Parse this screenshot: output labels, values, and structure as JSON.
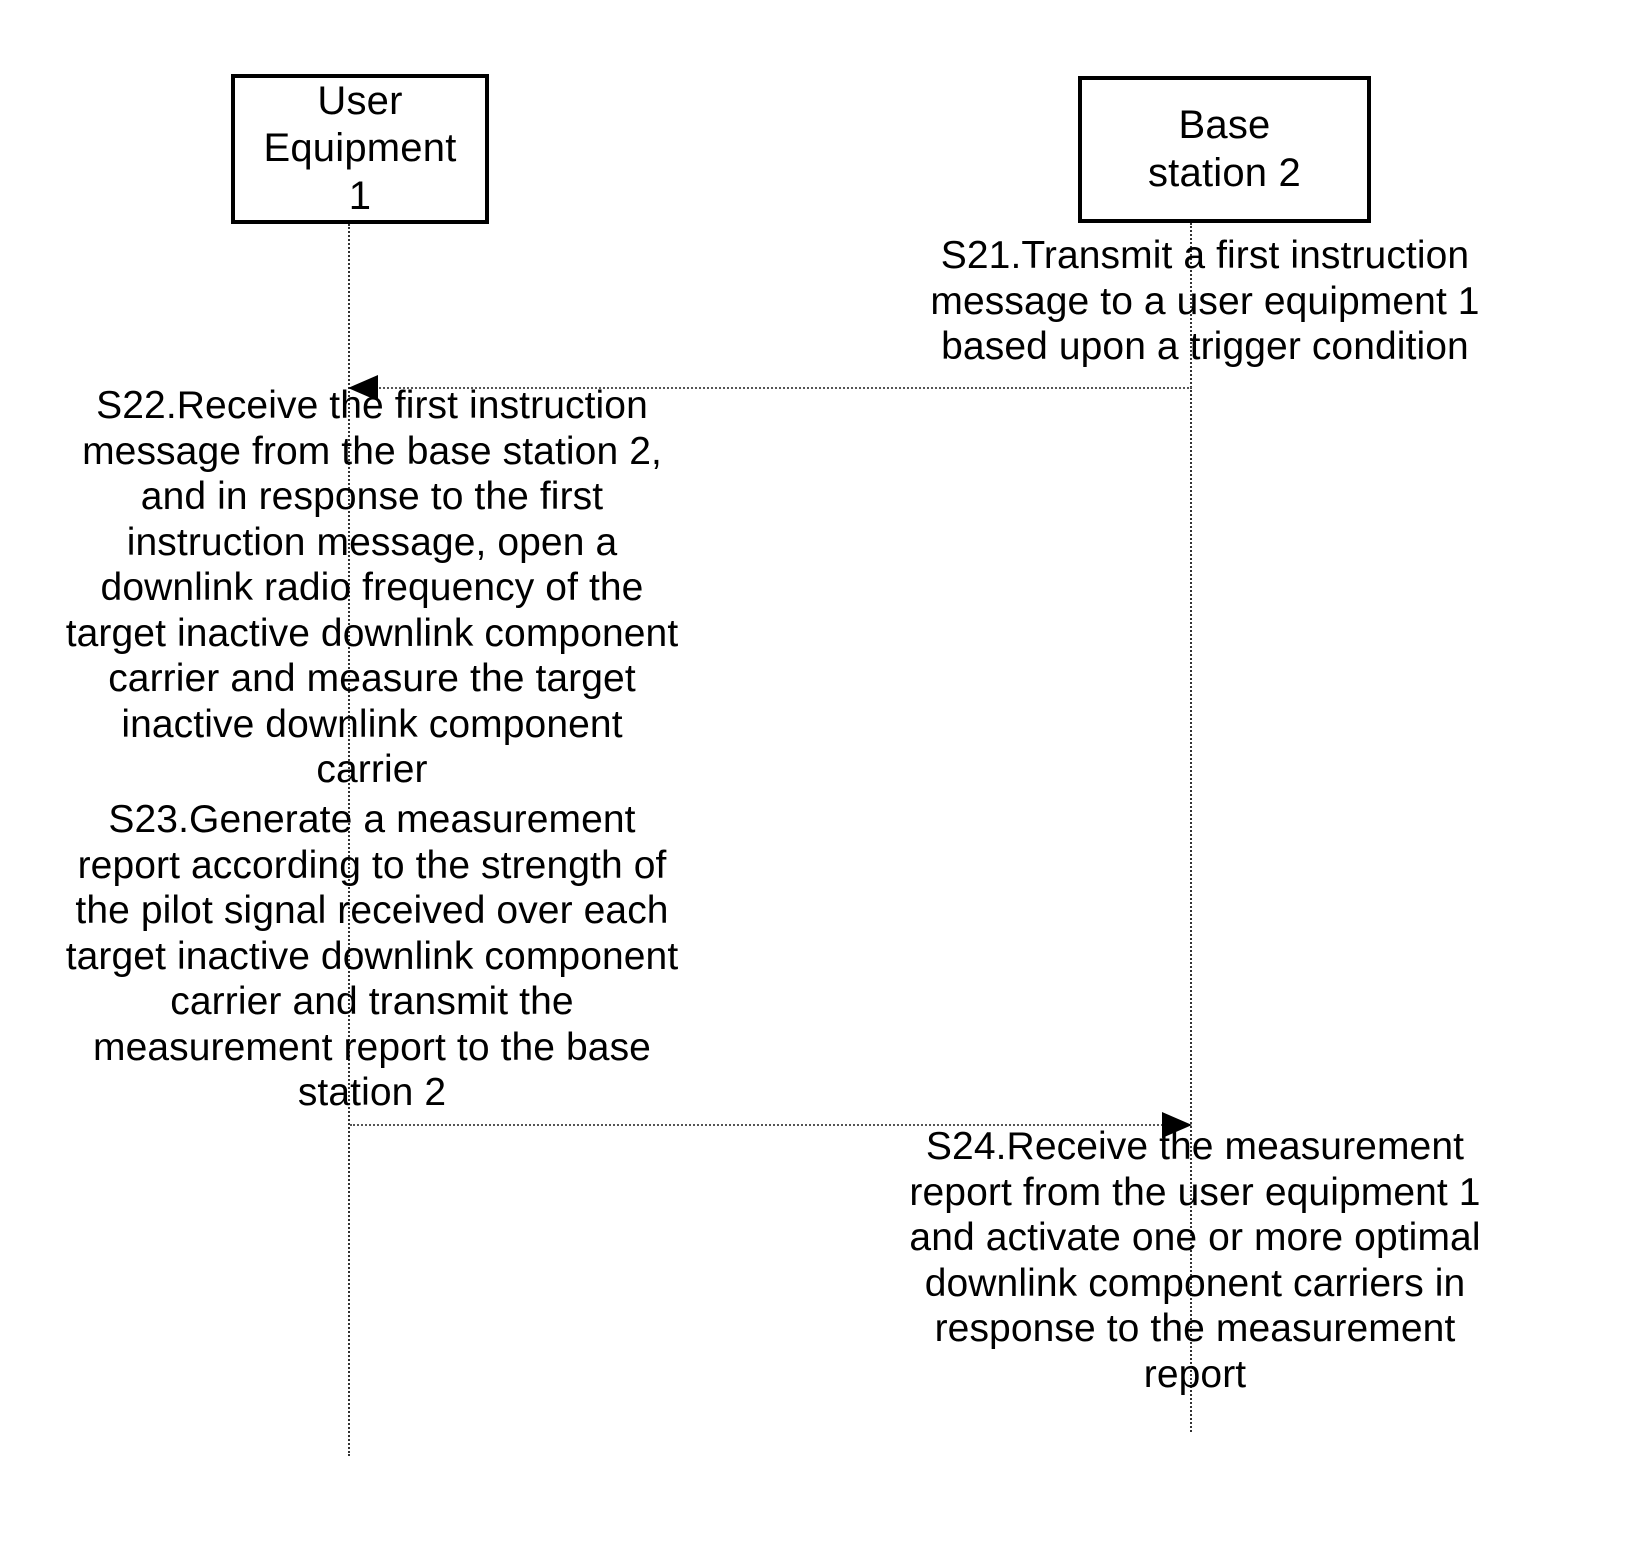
{
  "diagram": {
    "type": "sequence-diagram",
    "participants": [
      {
        "id": "user-equipment-1",
        "lines": [
          "User",
          "Equipment",
          "1"
        ],
        "label": "User Equipment 1"
      },
      {
        "id": "base-station-2",
        "lines": [
          "Base",
          "station 2"
        ],
        "label": "Base station 2"
      }
    ],
    "steps": [
      {
        "id": "S21",
        "text": "S21.Transmit a first instruction message to a user equipment 1 based upon a trigger condition",
        "actor": "base-station-2"
      },
      {
        "id": "S22",
        "text": "S22.Receive the first instruction message from the base station 2, and in response to the first instruction message, open a downlink radio frequency of the target inactive downlink component carrier and measure the target inactive downlink component carrier",
        "actor": "user-equipment-1"
      },
      {
        "id": "S23",
        "text": "S23.Generate a measurement report according to the strength of the pilot signal received over each target inactive downlink component carrier and transmit the measurement report to the base station 2",
        "actor": "user-equipment-1"
      },
      {
        "id": "S24",
        "text": "S24.Receive the measurement report from the user equipment 1 and activate one or more optimal downlink component carriers in response to the measurement report",
        "actor": "base-station-2"
      }
    ],
    "messages": [
      {
        "id": "msg-s22",
        "from": "base-station-2",
        "to": "user-equipment-1",
        "direction": "left",
        "style": "dotted"
      },
      {
        "id": "msg-s24",
        "from": "user-equipment-1",
        "to": "base-station-2",
        "direction": "right",
        "style": "dotted"
      }
    ],
    "colors": {
      "line": "#000000",
      "background": "#ffffff",
      "lifeline": "#333333"
    }
  }
}
